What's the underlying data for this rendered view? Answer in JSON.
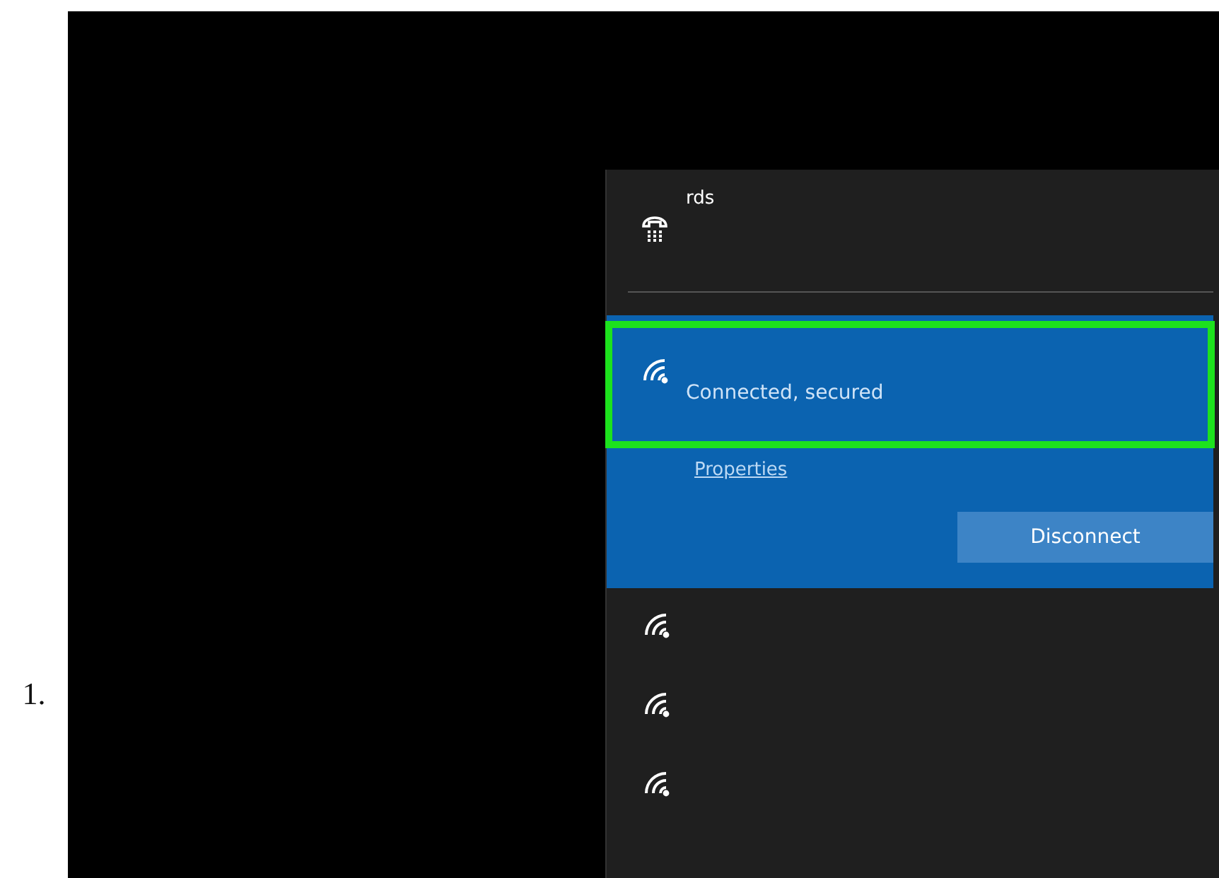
{
  "list_marker": "1.",
  "flyout": {
    "networks": [
      {
        "kind": "wired",
        "name": "rds",
        "selected": false
      },
      {
        "kind": "wifi",
        "selected": true,
        "highlighted": true,
        "status": "Connected, secured",
        "link": "Properties",
        "button": "Disconnect"
      },
      {
        "kind": "wifi",
        "selected": false
      },
      {
        "kind": "wifi",
        "selected": false
      },
      {
        "kind": "wifi",
        "selected": false
      }
    ]
  }
}
